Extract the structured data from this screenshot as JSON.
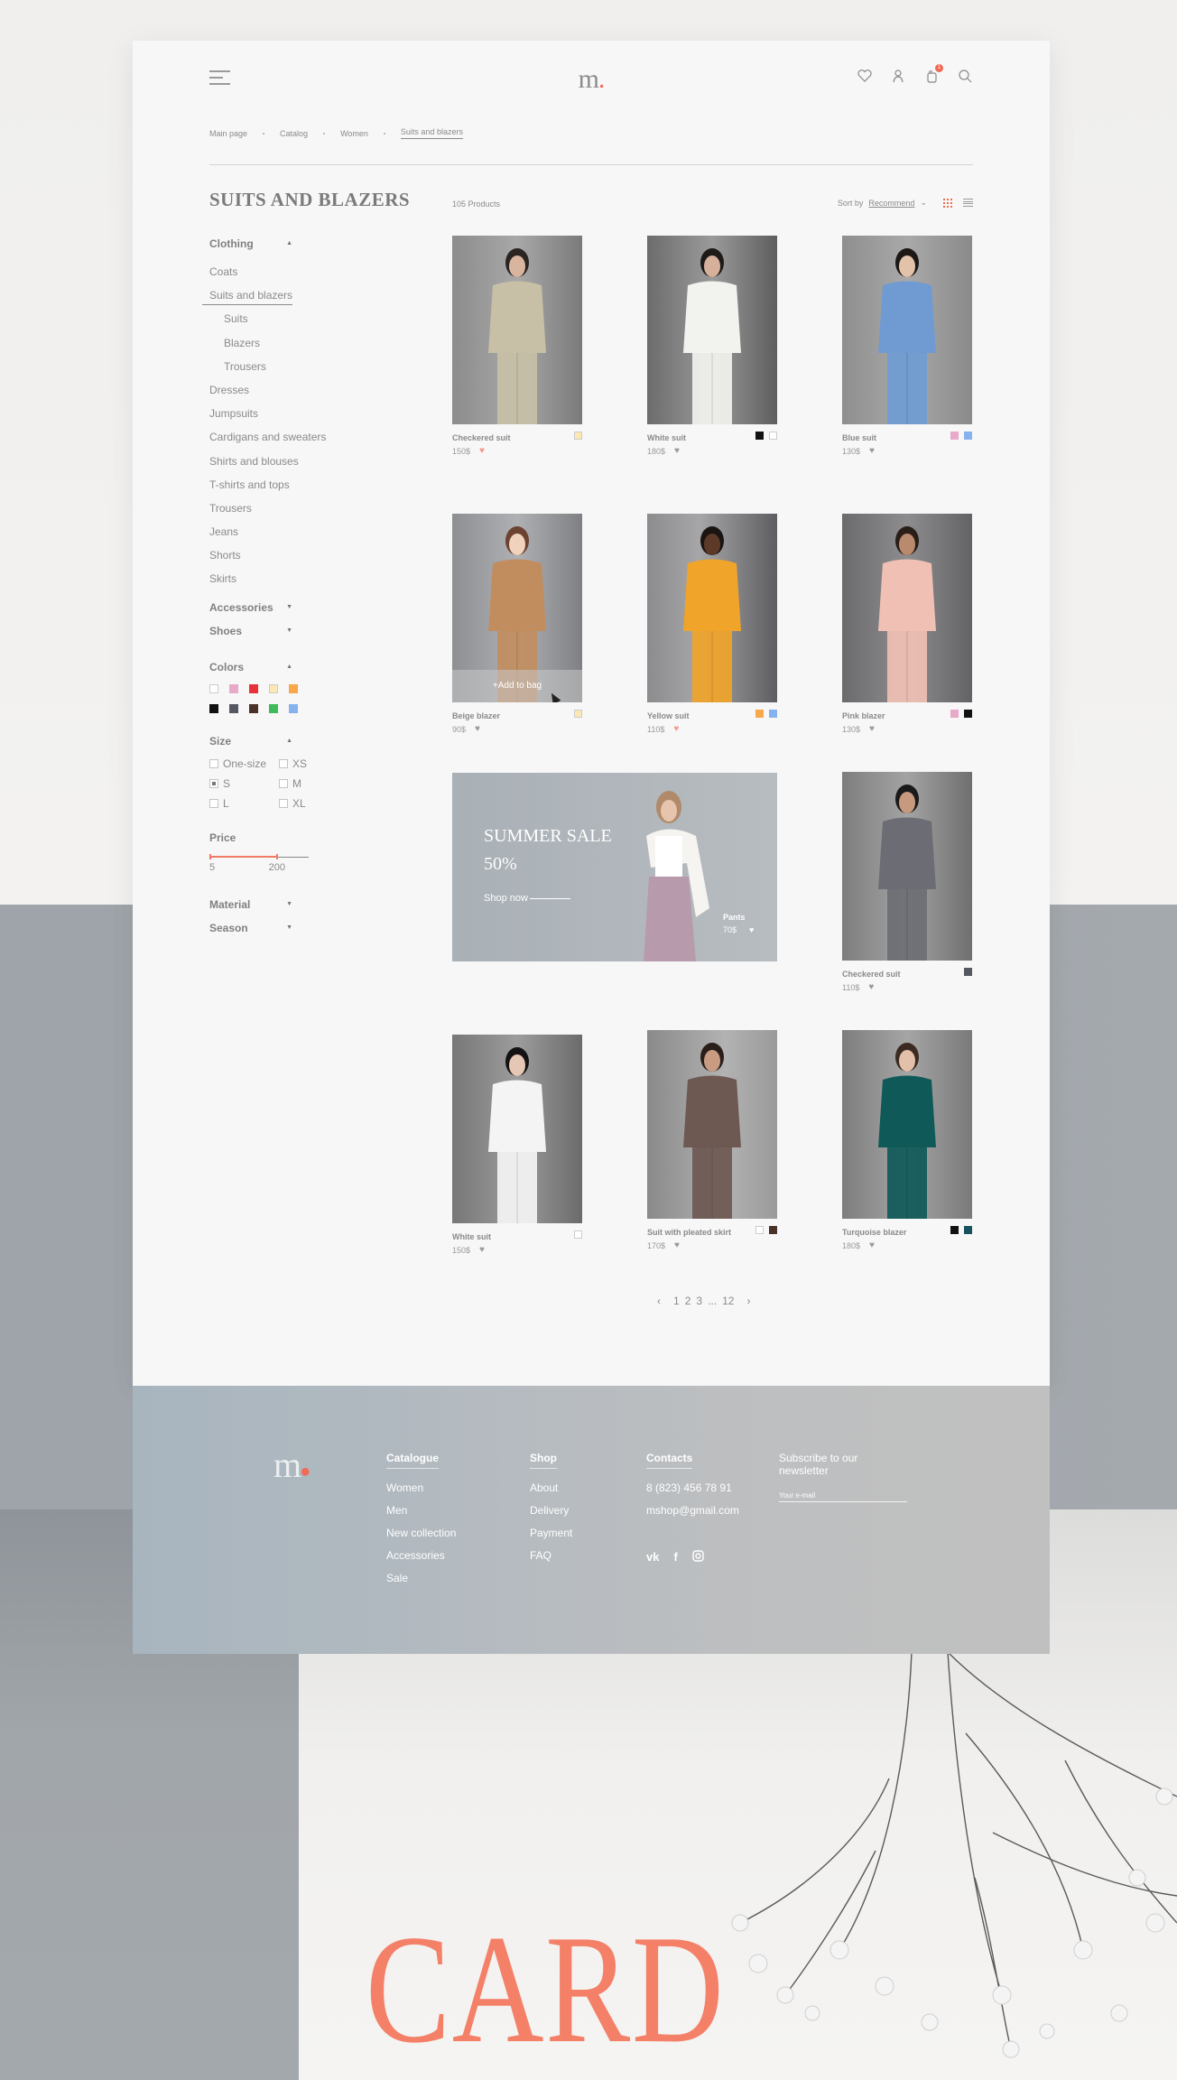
{
  "header": {
    "logo": "m",
    "logo_dot": ".",
    "cart_count": "1",
    "icons": [
      "menu-icon",
      "heart-icon",
      "user-icon",
      "bag-icon",
      "search-icon"
    ]
  },
  "breadcrumb": [
    "Main page",
    "Catalog",
    "Women",
    "Suits and blazers"
  ],
  "page_title": "SUITS AND BLAZERS",
  "sidebar": {
    "clothing": {
      "label": "Clothing",
      "items": [
        {
          "label": "Coats",
          "sub": false
        },
        {
          "label": "Suits and blazers",
          "sub": false,
          "active": true
        },
        {
          "label": "Suits",
          "sub": true
        },
        {
          "label": "Blazers",
          "sub": true
        },
        {
          "label": "Trousers",
          "sub": true
        },
        {
          "label": "Dresses",
          "sub": false
        },
        {
          "label": "Jumpsuits",
          "sub": false
        },
        {
          "label": "Cardigans and sweaters",
          "sub": false
        },
        {
          "label": "Shirts and blouses",
          "sub": false
        },
        {
          "label": "T-shirts and tops",
          "sub": false
        },
        {
          "label": "Trousers",
          "sub": false
        },
        {
          "label": "Jeans",
          "sub": false
        },
        {
          "label": "Shorts",
          "sub": false
        },
        {
          "label": "Skirts",
          "sub": false
        }
      ]
    },
    "accessories_label": "Accessories",
    "shoes_label": "Shoes",
    "colors_label": "Colors",
    "colors": [
      "#ffffff",
      "#e9a9c8",
      "#e8323a",
      "#fde8b4",
      "#f8a84a",
      "#111111",
      "#555860",
      "#4a3228",
      "#3fbb5b",
      "#86b2ee"
    ],
    "size_label": "Size",
    "sizes": [
      {
        "label": "One-size",
        "checked": false
      },
      {
        "label": "XS",
        "checked": false
      },
      {
        "label": "S",
        "checked": true
      },
      {
        "label": "M",
        "checked": false
      },
      {
        "label": "L",
        "checked": false
      },
      {
        "label": "XL",
        "checked": false
      }
    ],
    "price_label": "Price",
    "price_min": "5",
    "price_max": "200",
    "material_label": "Material",
    "season_label": "Season"
  },
  "toolbar": {
    "count": "105 Products",
    "sort_label": "Sort by",
    "sort_value": "Recommend"
  },
  "products": [
    {
      "name": "Checkered suit",
      "price": "150$",
      "liked": true,
      "colors": [
        "#fde8b4"
      ],
      "img": "checkered"
    },
    {
      "name": "White suit",
      "price": "180$",
      "liked": false,
      "colors": [
        "#111111",
        "#ffffff"
      ],
      "img": "white"
    },
    {
      "name": "Blue suit",
      "price": "130$",
      "liked": false,
      "colors": [
        "#e9a9c8",
        "#86b2ee"
      ],
      "img": "blue"
    },
    {
      "name": "Beige blazer",
      "price": "90$",
      "liked": false,
      "colors": [
        "#fde8b4"
      ],
      "img": "beige",
      "hover": "+Add to bag"
    },
    {
      "name": "Yellow suit",
      "price": "110$",
      "liked": true,
      "colors": [
        "#f8a84a",
        "#86b2ee"
      ],
      "img": "yellow"
    },
    {
      "name": "Pink blazer",
      "price": "130$",
      "liked": false,
      "colors": [
        "#e9a9c8",
        "#111111"
      ],
      "img": "pink"
    },
    {
      "name": "Checkered suit",
      "price": "110$",
      "liked": false,
      "colors": [
        "#555860"
      ],
      "img": "checkgray"
    },
    {
      "name": "White suit",
      "price": "150$",
      "liked": false,
      "colors": [
        "#ffffff"
      ],
      "img": "white2"
    },
    {
      "name": "Suit with pleated skirt",
      "price": "170$",
      "liked": false,
      "colors": [
        "#ffffff",
        "#4a3228"
      ],
      "img": "brown"
    },
    {
      "name": "Turquoise blazer",
      "price": "180$",
      "liked": false,
      "colors": [
        "#111111",
        "#17525e"
      ],
      "img": "teal"
    }
  ],
  "banner": {
    "title": "SUMMER SALE",
    "discount": "50%",
    "cta": "Shop now",
    "product_name": "Pants",
    "product_price": "70$"
  },
  "pagination": {
    "prev": "‹",
    "pages": [
      "1",
      "2",
      "3",
      "...",
      "12"
    ],
    "next": "›"
  },
  "footer": {
    "logo": "m",
    "catalogue": {
      "title": "Catalogue",
      "links": [
        "Women",
        "Men",
        "New collection",
        "Accessories",
        "Sale"
      ]
    },
    "shop": {
      "title": "Shop",
      "links": [
        "About",
        "Delivery",
        "Payment",
        "FAQ"
      ]
    },
    "contacts": {
      "title": "Contacts",
      "phone": "8 (823) 456 78 91",
      "email": "mshop@gmail.com",
      "social": [
        "vk",
        "facebook",
        "instagram"
      ]
    },
    "newsletter": {
      "title": "Subscribe to our newsletter",
      "placeholder": "Your e-mail"
    }
  },
  "decor_word": "CARD"
}
